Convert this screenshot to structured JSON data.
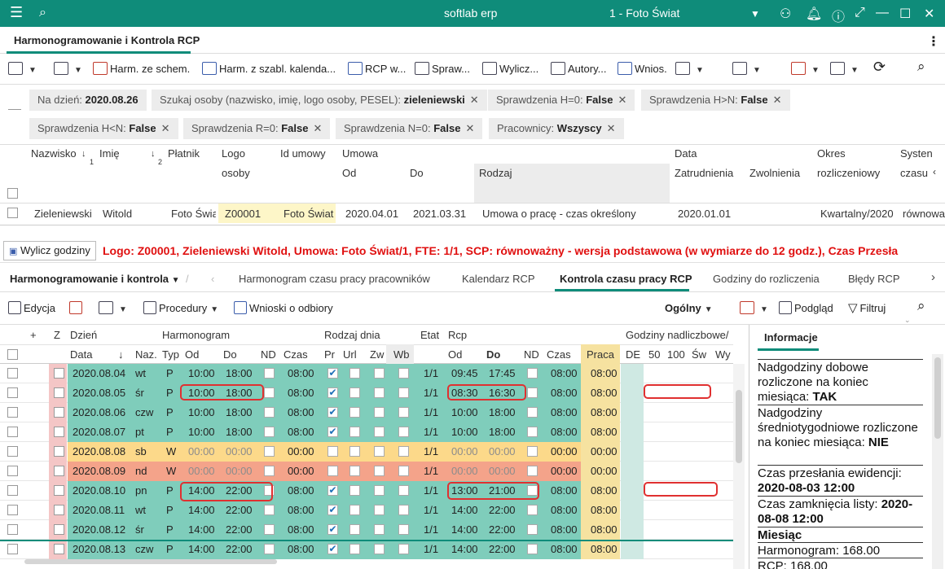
{
  "app": {
    "title": "softlab erp",
    "company": "1 - Foto Świat",
    "tab": "Harmonogramowanie i Kontrola RCP"
  },
  "toolbar1": {
    "items": [
      "Harm. ze schem.",
      "Harm. z szabl. kalenda...",
      "RCP w...",
      "Spraw...",
      "Wylicz...",
      "Autory...",
      "Wnios."
    ]
  },
  "filters": [
    {
      "label": "Na dzień:",
      "value": "2020.08.26"
    },
    {
      "label": "Szukaj osoby (nazwisko, imię, logo osoby, PESEL):",
      "value": "zieleniewski"
    },
    {
      "label": "Sprawdzenia  H=0:",
      "value": "False"
    },
    {
      "label": "Sprawdzenia  H>N:",
      "value": "False"
    },
    {
      "label": "Sprawdzenia  H<N:",
      "value": "False"
    },
    {
      "label": "Sprawdzenia  R=0:",
      "value": "False"
    },
    {
      "label": "Sprawdzenia  N=0:",
      "value": "False"
    },
    {
      "label": "Pracownicy:",
      "value": "Wszyscy"
    }
  ],
  "grid1": {
    "headers": {
      "nazwisko": "Nazwisko",
      "imie": "Imię",
      "platnik": "Płatnik",
      "logo1": "Logo",
      "logo2": "osoby",
      "idumowy": "Id umowy",
      "umowa": "Umowa",
      "od": "Od",
      "do": "Do",
      "rodzaj": "Rodzaj",
      "data": "Data",
      "zatr": "Zatrudnienia",
      "zwol": "Zwolnienia",
      "okres1": "Okres",
      "okres2": "rozliczeniowy",
      "sys1": "Systen",
      "sys2": "czasu",
      "sort1": "1",
      "sort2": "2"
    },
    "row": {
      "nazwisko": "Zieleniewski",
      "imie": "Witold",
      "platnik": "Foto Świa",
      "logo": "Z00001",
      "idumowy": "Foto Świat",
      "od": "2020.04.01",
      "do": "2021.03.31",
      "rodzaj": "Umowa o pracę - czas określony",
      "zatr": "2020.01.01",
      "okres": "Kwartalny/2020",
      "system": "równowa"
    }
  },
  "wylicz_label": "Wylicz godziny",
  "red_info": "Logo: Z00001, Zieleniewski Witold, Umowa: Foto Świat/1, FTE: 1/1, SCP: równoważny - wersja podstawowa (w wymiarze do 12 godz.), Czas Przesła",
  "tabs2": {
    "module": "Harmonogramowanie i kontrola",
    "items": [
      "Harmonogram czasu pracy pracowników",
      "Kalendarz RCP",
      "Kontrola czasu pracy RCP",
      "Godziny do rozliczenia",
      "Błędy RCP"
    ],
    "active": 2
  },
  "toolbar2": {
    "edycja": "Edycja",
    "procedury": "Procedury",
    "wnioski": "Wnioski o odbiory",
    "ogolny": "Ogólny",
    "podglad": "Podgląd",
    "filtruj": "Filtruj"
  },
  "grid2": {
    "group_headers": {
      "z": "Z",
      "dzien": "Dzień",
      "harm": "Harmonogram",
      "rodzaj": "Rodzaj dnia",
      "etat": "Etat",
      "rcp": "Rcp",
      "nadl": "Godziny nadliczbowe/"
    },
    "col_headers": {
      "data": "Data",
      "naz": "Naz.",
      "typ": "Typ",
      "od": "Od",
      "do": "Do",
      "nd": "ND",
      "czas": "Czas",
      "pr": "Pr",
      "url": "Url",
      "zw": "Zw",
      "wb": "Wb",
      "rod": "Od",
      "rdo": "Do",
      "rnd": "ND",
      "rczas": "Czas",
      "praca": "Praca",
      "de": "DE",
      "n50": "50",
      "n100": "100",
      "sw": "Św",
      "wy": "Wy"
    },
    "rows": [
      {
        "data": "2020.08.04",
        "naz": "wt",
        "typ": "P",
        "od": "10:00",
        "do": "18:00",
        "czas": "08:00",
        "pr": true,
        "etat": "1/1",
        "rod": "09:45",
        "rdo": "17:45",
        "rczas": "08:00",
        "praca": "08:00",
        "kind": "work"
      },
      {
        "data": "2020.08.05",
        "naz": "śr",
        "typ": "P",
        "od": "10:00",
        "do": "18:00",
        "czas": "08:00",
        "pr": true,
        "etat": "1/1",
        "rod": "08:30",
        "rdo": "16:30",
        "rczas": "08:00",
        "praca": "08:00",
        "kind": "work"
      },
      {
        "data": "2020.08.06",
        "naz": "czw",
        "typ": "P",
        "od": "10:00",
        "do": "18:00",
        "czas": "08:00",
        "pr": true,
        "etat": "1/1",
        "rod": "10:00",
        "rdo": "18:00",
        "rczas": "08:00",
        "praca": "08:00",
        "kind": "work"
      },
      {
        "data": "2020.08.07",
        "naz": "pt",
        "typ": "P",
        "od": "10:00",
        "do": "18:00",
        "czas": "08:00",
        "pr": true,
        "etat": "1/1",
        "rod": "10:00",
        "rdo": "18:00",
        "rczas": "08:00",
        "praca": "08:00",
        "kind": "work"
      },
      {
        "data": "2020.08.08",
        "naz": "sb",
        "typ": "W",
        "od": "00:00",
        "do": "00:00",
        "czas": "00:00",
        "pr": false,
        "etat": "1/1",
        "rod": "00:00",
        "rdo": "00:00",
        "rczas": "00:00",
        "praca": "00:00",
        "kind": "sat"
      },
      {
        "data": "2020.08.09",
        "naz": "nd",
        "typ": "W",
        "od": "00:00",
        "do": "00:00",
        "czas": "00:00",
        "pr": false,
        "etat": "1/1",
        "rod": "00:00",
        "rdo": "00:00",
        "rczas": "00:00",
        "praca": "00:00",
        "kind": "sun"
      },
      {
        "data": "2020.08.10",
        "naz": "pn",
        "typ": "P",
        "od": "14:00",
        "do": "22:00",
        "czas": "08:00",
        "pr": true,
        "etat": "1/1",
        "rod": "13:00",
        "rdo": "21:00",
        "rczas": "08:00",
        "praca": "08:00",
        "kind": "work"
      },
      {
        "data": "2020.08.11",
        "naz": "wt",
        "typ": "P",
        "od": "14:00",
        "do": "22:00",
        "czas": "08:00",
        "pr": true,
        "etat": "1/1",
        "rod": "14:00",
        "rdo": "22:00",
        "rczas": "08:00",
        "praca": "08:00",
        "kind": "work"
      },
      {
        "data": "2020.08.12",
        "naz": "śr",
        "typ": "P",
        "od": "14:00",
        "do": "22:00",
        "czas": "08:00",
        "pr": true,
        "etat": "1/1",
        "rod": "14:00",
        "rdo": "22:00",
        "rczas": "08:00",
        "praca": "08:00",
        "kind": "work"
      },
      {
        "data": "2020.08.13",
        "naz": "czw",
        "typ": "P",
        "od": "14:00",
        "do": "22:00",
        "czas": "08:00",
        "pr": true,
        "etat": "1/1",
        "rod": "14:00",
        "rdo": "22:00",
        "rczas": "08:00",
        "praca": "08:00",
        "kind": "work"
      }
    ]
  },
  "info": {
    "title": "Informacje",
    "lines": [
      {
        "text": "Nadgodziny dobowe rozliczone na koniec miesiąca: ",
        "bold": "TAK"
      },
      {
        "text": "Nadgodziny średniotygodniowe rozliczone na koniec miesiąca: ",
        "bold": "NIE"
      },
      {
        "text": "Czas przesłania ewidencji: ",
        "bold": "2020-08-03 12:00"
      },
      {
        "text": "Czas zamknięcia listy: ",
        "bold": "2020-08-08 12:00"
      },
      {
        "text": "",
        "bold": "Miesiąc"
      },
      {
        "text": "Harmonogram: 168.00",
        "bold": ""
      },
      {
        "text": "RCP: 168.00",
        "bold": ""
      }
    ]
  },
  "colors": {
    "teal": "#0f8c7a",
    "work": "#7fcdbb",
    "sat": "#fcd98a",
    "sun": "#f4a38a",
    "praca": "#f6e2a0",
    "accent_red": "#e01010"
  }
}
